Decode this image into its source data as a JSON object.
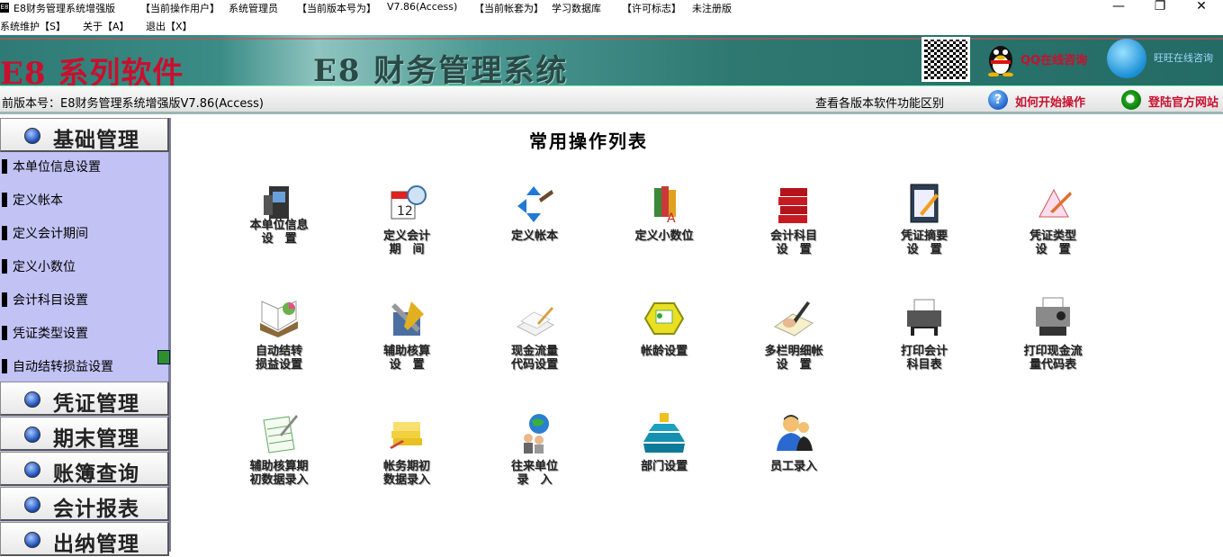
{
  "titlebar": {
    "app_icon": "E8",
    "app_title": "E8财务管理系统增强版",
    "user_label": "【当前操作用户】",
    "user_value": "系统管理员",
    "version_label": "【当前版本号为】",
    "version_value": "V7.86(Access)",
    "account_label": "【当前帐套为】",
    "account_value": "学习数据库",
    "license_label": "【许可标志】",
    "license_value": "未注册版",
    "minimize": "—",
    "maximize": "❐",
    "close": "✕"
  },
  "menu": {
    "items": [
      "系统维护【S】",
      "关于【A】",
      "退出【X】"
    ]
  },
  "banner": {
    "brand": "E8 系列软件",
    "system_name": "E8 财务管理系统",
    "qq_label": "QQ在线咨询",
    "bubble_label": "旺旺在线咨询"
  },
  "status": {
    "version_text": "前版本号：E8财务管理系统增强版V7.86(Access)",
    "diff_text": "查看各版本软件功能区别",
    "howto_text": "如何开始操作",
    "login_text": "登陆官方网站"
  },
  "sidebar": {
    "sections": [
      "基础管理",
      "凭证管理",
      "期末管理",
      "账簿查询",
      "会计报表",
      "出纳管理"
    ],
    "items": [
      "本单位信息设置",
      "定义帐本",
      "定义会计期间",
      "定义小数位",
      "会计科目设置",
      "凭证类型设置",
      "自动结转损益设置"
    ]
  },
  "main": {
    "title": "常用操作列表",
    "tiles": [
      {
        "label": "本单位信息\n设　置",
        "icon": "camera-icon"
      },
      {
        "label": "定义会计\n期　间",
        "icon": "calendar-clock-icon"
      },
      {
        "label": "定义帐本",
        "icon": "arrows-pen-icon"
      },
      {
        "label": "定义小数位",
        "icon": "books-abc-icon"
      },
      {
        "label": "会计科目\n设　置",
        "icon": "red-books-icon"
      },
      {
        "label": "凭证摘要\n设　置",
        "icon": "notepad-icon"
      },
      {
        "label": "凭证类型\n设　置",
        "icon": "pencil-tent-icon"
      },
      {
        "label": "自动结转\n损益设置",
        "icon": "open-book-chart-icon"
      },
      {
        "label": "辅助核算\n设　置",
        "icon": "tools-icon"
      },
      {
        "label": "现金流量\n代码设置",
        "icon": "paper-pen-icon"
      },
      {
        "label": "帐龄设置",
        "icon": "hexagon-note-icon"
      },
      {
        "label": "多栏明细帐\n设　置",
        "icon": "signing-hand-icon"
      },
      {
        "label": "打印会计\n科目表",
        "icon": "printer-icon"
      },
      {
        "label": "打印现金流\n量代码表",
        "icon": "fax-printer-icon"
      },
      {
        "label": "辅助核算期\n初数据录入",
        "icon": "spreadsheet-pen-icon"
      },
      {
        "label": "帐务期初\n数据录入",
        "icon": "notebook-stack-icon"
      },
      {
        "label": "往来单位\n录　入",
        "icon": "globe-people-icon"
      },
      {
        "label": "部门设置",
        "icon": "pyramid-blocks-icon"
      },
      {
        "label": "员工录入",
        "icon": "employees-icon"
      }
    ]
  },
  "colors": {
    "brand_red": "#c8102e",
    "banner_teal": "#2e7871",
    "sidebar_lavender": "#c2c2f5"
  }
}
